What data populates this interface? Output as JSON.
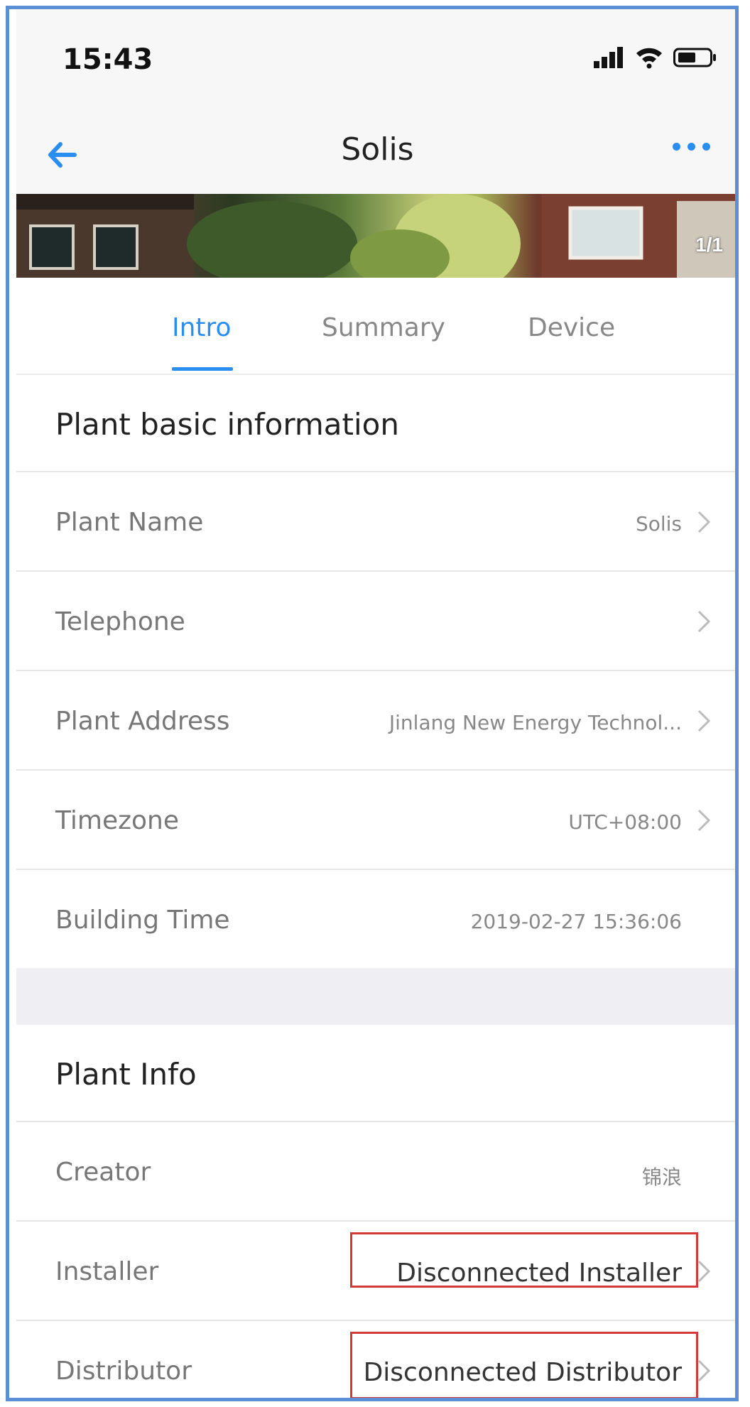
{
  "status_bar": {
    "time": "15:43"
  },
  "nav": {
    "title": "Solis",
    "back_icon": "arrow-left-icon",
    "more_icon": "more-horizontal-icon"
  },
  "banner": {
    "counter": "1/1"
  },
  "tabs": [
    {
      "label": "Intro",
      "active": true
    },
    {
      "label": "Summary",
      "active": false
    },
    {
      "label": "Device",
      "active": false
    }
  ],
  "basic_info": {
    "title": "Plant basic information",
    "rows": [
      {
        "label": "Plant Name",
        "value": "Solis"
      },
      {
        "label": "Telephone",
        "value": ""
      },
      {
        "label": "Plant Address",
        "value": "Jinlang New Energy Technol..."
      },
      {
        "label": "Timezone",
        "value": "UTC+08:00"
      },
      {
        "label": "Building Time",
        "value": "2019-02-27 15:36:06"
      }
    ]
  },
  "plant_info": {
    "title": "Plant Info",
    "rows": [
      {
        "label": "Creator",
        "value": "锦浪"
      },
      {
        "label": "Installer",
        "value": "Disconnected Installer"
      },
      {
        "label": "Distributor",
        "value": "Disconnected Distributor"
      }
    ]
  },
  "colors": {
    "accent": "#2a8ef0",
    "highlight_border": "#d23a3a",
    "frame_border": "#5b8fd6"
  }
}
